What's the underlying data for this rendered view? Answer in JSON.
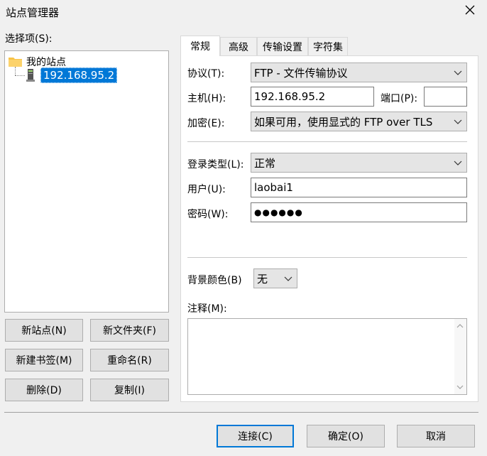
{
  "window": {
    "title": "站点管理器"
  },
  "left": {
    "select_label": "选择项(S):",
    "tree": {
      "root": "我的站点",
      "child": "192.168.95.2"
    },
    "buttons": {
      "new_site": "新站点(N)",
      "new_folder": "新文件夹(F)",
      "new_bookmark": "新建书签(M)",
      "rename": "重命名(R)",
      "delete": "删除(D)",
      "copy": "复制(I)"
    }
  },
  "tabs": [
    "常规",
    "高级",
    "传输设置",
    "字符集"
  ],
  "general": {
    "protocol_label": "协议(T):",
    "protocol_value": "FTP - 文件传输协议",
    "host_label": "主机(H):",
    "host_value": "192.168.95.2",
    "port_label": "端口(P):",
    "port_value": "",
    "encryption_label": "加密(E):",
    "encryption_value": "如果可用，使用显式的 FTP over TLS",
    "logon_type_label": "登录类型(L):",
    "logon_type_value": "正常",
    "user_label": "用户(U):",
    "user_value": "laobai1",
    "password_label": "密码(W):",
    "password_value": "●●●●●●",
    "bg_color_label": "背景颜色(B)",
    "bg_color_value": "无",
    "comments_label": "注释(M):",
    "comments_value": ""
  },
  "footer": {
    "connect": "连接(C)",
    "ok": "确定(O)",
    "cancel": "取消"
  },
  "colors": {
    "accent": "#0078d7",
    "folder": "#f8c348"
  }
}
